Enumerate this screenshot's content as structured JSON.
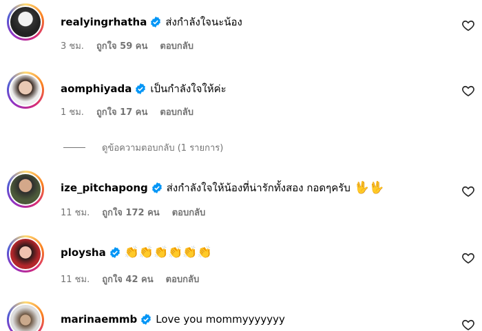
{
  "comments": [
    {
      "username": "realyingrhatha",
      "text": "ส่งกำลังใจนะน้อง",
      "time": "3 ชม.",
      "likes": "ถูกใจ 59 คน",
      "reply": "ตอบกลับ"
    },
    {
      "username": "aomphiyada",
      "text": "เป็นกำลังใจให้ค่ะ",
      "time": "1 ชม.",
      "likes": "ถูกใจ 17 คน",
      "reply": "ตอบกลับ",
      "view_replies": "ดูข้อความตอบกลับ (1 รายการ)"
    },
    {
      "username": "ize_pitchapong",
      "text": "ส่งกำลังใจให้น้องที่น่ารักทั้งสอง กอดๆครับ",
      "emoji": "🖖🖖",
      "time": "11 ชม.",
      "likes": "ถูกใจ 172 คน",
      "reply": "ตอบกลับ"
    },
    {
      "username": "ploysha",
      "emoji": "👏👏👏👏👏👏",
      "time": "11 ชม.",
      "likes": "ถูกใจ 42 คน",
      "reply": "ตอบกลับ"
    },
    {
      "username": "marinaemmb",
      "text": "Love you mommyyyyyyy"
    }
  ],
  "colors": {
    "secondary_text": "#737373",
    "verified": "#0095f6",
    "ring_start": "#feda75",
    "ring_end": "#962fbf"
  }
}
